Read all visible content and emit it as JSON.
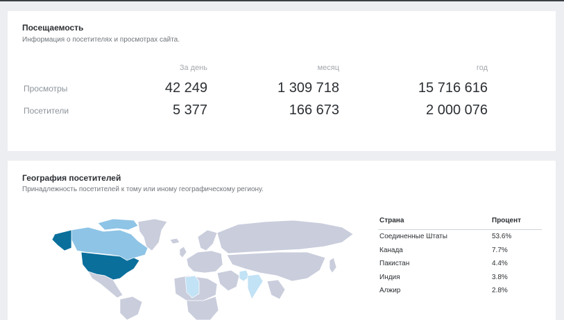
{
  "traffic": {
    "title": "Посещаемость",
    "subtitle": "Информация о посетителях и просмотрах сайта.",
    "headers": [
      "За день",
      "месяц",
      "год"
    ],
    "rows": [
      {
        "label": "Просмотры",
        "values": [
          "42 249",
          "1 309 718",
          "15 716 616"
        ]
      },
      {
        "label": "Посетители",
        "values": [
          "5 377",
          "166 673",
          "2 000 076"
        ]
      }
    ]
  },
  "geo": {
    "title": "География посетителей",
    "subtitle": "Принадлежность посетителей к тому или иному географическому региону.",
    "table_headers": {
      "country": "Страна",
      "percent": "Процент"
    },
    "countries": [
      {
        "name": "Соединенные Штаты",
        "percent": "53.6%"
      },
      {
        "name": "Канада",
        "percent": "7.7%"
      },
      {
        "name": "Пакистан",
        "percent": "4.4%"
      },
      {
        "name": "Индия",
        "percent": "3.8%"
      },
      {
        "name": "Алжир",
        "percent": "2.8%"
      }
    ],
    "map_colors": {
      "base": "#c9cddc",
      "level_high": "#0b6f9c",
      "level_mid": "#8ec4e6",
      "level_low": "#c2e2f5",
      "border": "#ffffff"
    }
  }
}
